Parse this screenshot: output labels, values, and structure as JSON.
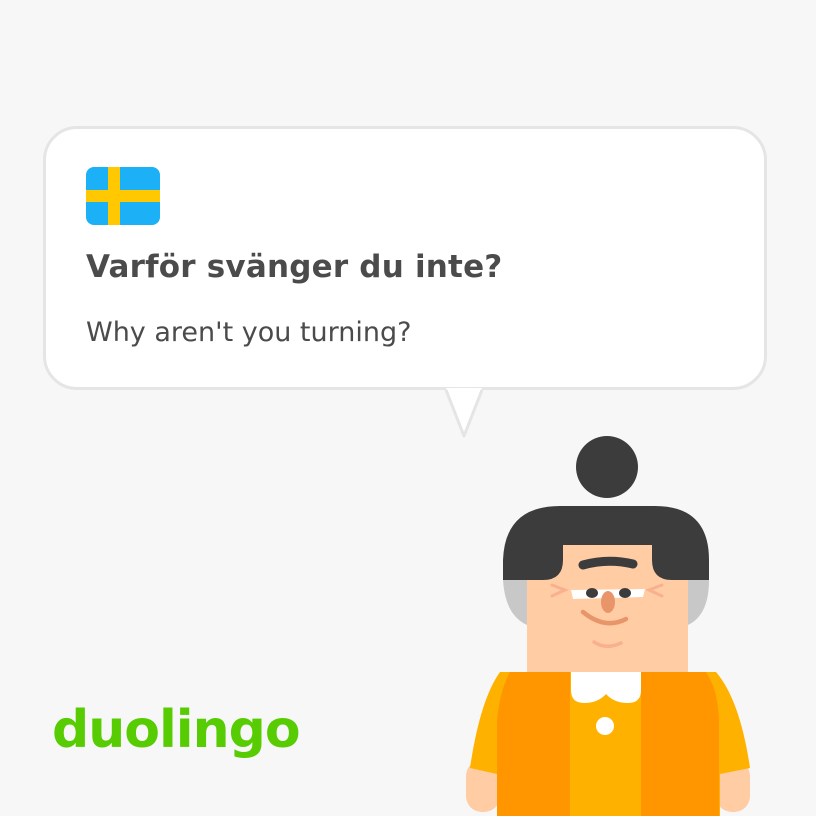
{
  "card": {
    "flag_icon": "sweden-flag-icon",
    "sentence": "Varför svänger du inte?",
    "translation": "Why aren't you turning?"
  },
  "brand": {
    "logo_text": "duolingo",
    "color": "#58cc02"
  },
  "colors": {
    "flag_blue": "#1cb0f6",
    "flag_yellow": "#ffc800",
    "text": "#4b4b4b"
  }
}
